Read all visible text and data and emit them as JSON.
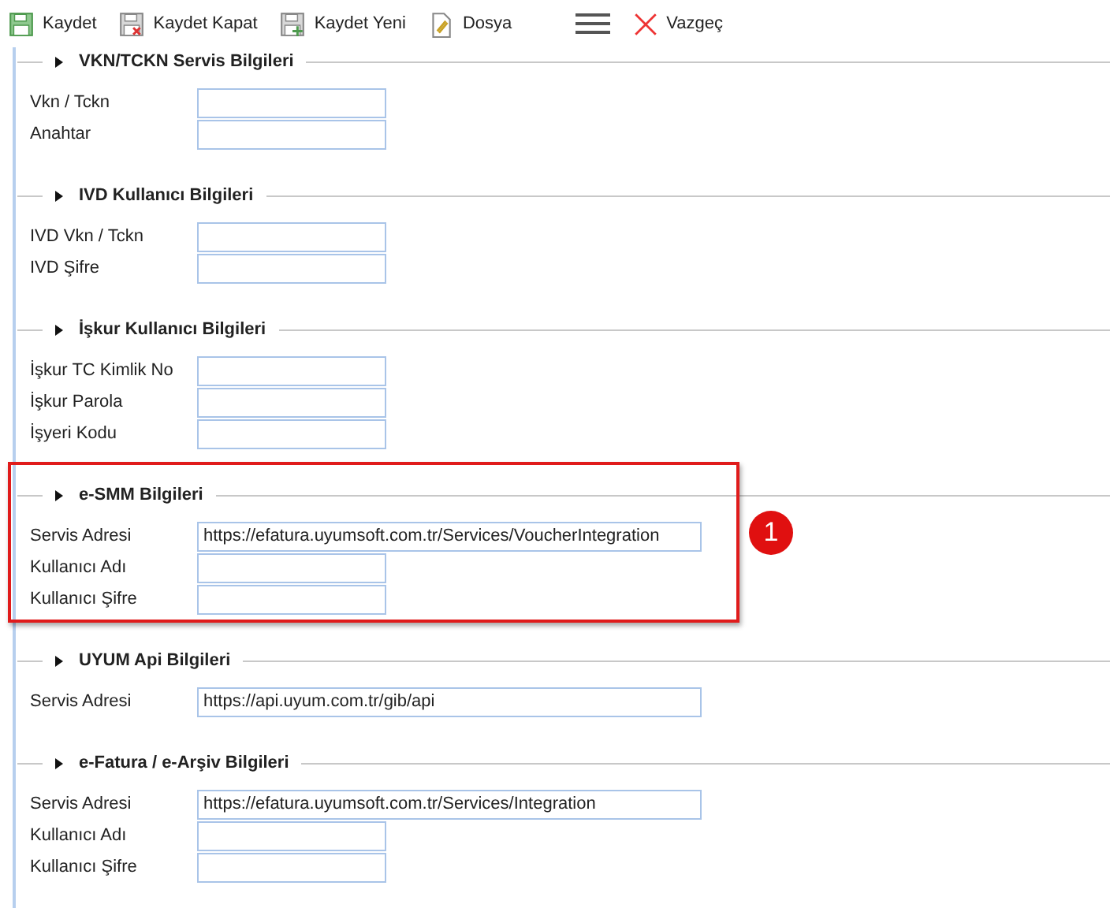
{
  "toolbar": [
    {
      "kind": "save",
      "label": "Kaydet"
    },
    {
      "kind": "save-close",
      "label": "Kaydet Kapat"
    },
    {
      "kind": "save-new",
      "label": "Kaydet Yeni"
    },
    {
      "kind": "file",
      "label": "Dosya"
    },
    {
      "kind": "menu"
    },
    {
      "kind": "cancel",
      "label": "Vazgeç"
    }
  ],
  "sections": [
    {
      "title": "VKN/TCKN Servis Bilgileri",
      "highlighted": false,
      "fields": [
        {
          "label": "Vkn / Tckn"
        },
        {
          "label": "Anahtar"
        }
      ]
    },
    {
      "title": "IVD Kullanıcı Bilgileri",
      "highlighted": false,
      "fields": [
        {
          "label": "IVD Vkn / Tckn"
        },
        {
          "label": "IVD Şifre"
        }
      ]
    },
    {
      "title": "İşkur Kullanıcı Bilgileri",
      "highlighted": false,
      "fields": [
        {
          "label": "İşkur TC Kimlik No"
        },
        {
          "label": "İşkur Parola"
        },
        {
          "label": "İşyeri Kodu"
        }
      ]
    },
    {
      "title": "e-SMM Bilgileri",
      "highlighted": true,
      "badge": "1",
      "fields": [
        {
          "label": "Servis Adresi",
          "value": "https://efatura.uyumsoft.com.tr/Services/VoucherIntegration"
        },
        {
          "label": "Kullanıcı Adı"
        },
        {
          "label": "Kullanıcı Şifre"
        }
      ]
    },
    {
      "title": "UYUM Api Bilgileri",
      "highlighted": false,
      "fields": [
        {
          "label": "Servis Adresi",
          "value": "https://api.uyum.com.tr/gib/api"
        }
      ]
    },
    {
      "title": "e-Fatura / e-Arşiv Bilgileri",
      "highlighted": false,
      "fields": [
        {
          "label": "Servis Adresi",
          "value": "https://efatura.uyumsoft.com.tr/Services/Integration"
        },
        {
          "label": "Kullanıcı Adı"
        },
        {
          "label": "Kullanıcı Şifre"
        }
      ]
    }
  ]
}
